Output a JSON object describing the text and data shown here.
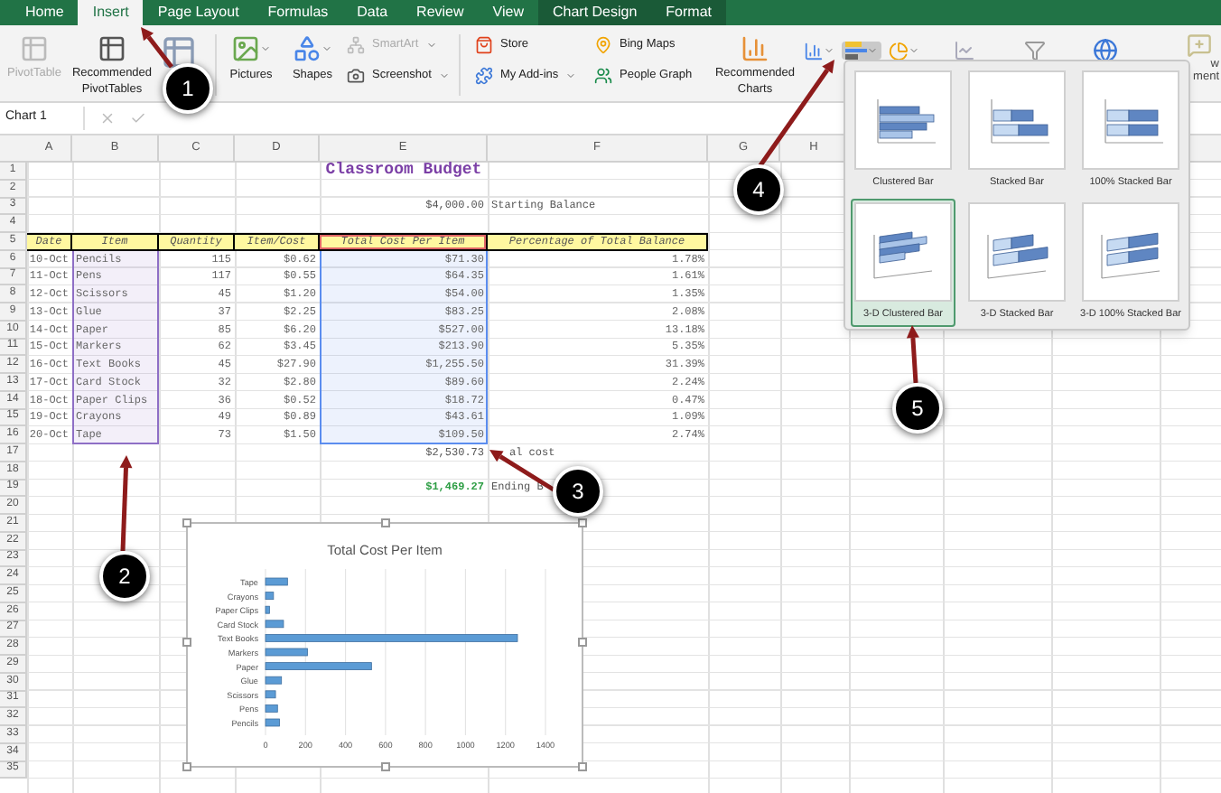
{
  "tabs": [
    {
      "label": "Home",
      "selected": false,
      "contextual": false
    },
    {
      "label": "Insert",
      "selected": true,
      "contextual": false
    },
    {
      "label": "Page Layout",
      "selected": false,
      "contextual": false
    },
    {
      "label": "Formulas",
      "selected": false,
      "contextual": false
    },
    {
      "label": "Data",
      "selected": false,
      "contextual": false
    },
    {
      "label": "Review",
      "selected": false,
      "contextual": false
    },
    {
      "label": "View",
      "selected": false,
      "contextual": false
    },
    {
      "label": "Chart Design",
      "selected": false,
      "contextual": true
    },
    {
      "label": "Format",
      "selected": false,
      "contextual": true
    }
  ],
  "ribbon": {
    "pivot_table": {
      "lines": [
        "PivotTable"
      ],
      "disabled": true
    },
    "recommended_pivot": {
      "lines": [
        "Recommended",
        "PivotTables"
      ],
      "disabled": false
    },
    "pictures": {
      "label": "Pictures"
    },
    "shapes": {
      "label": "Shapes"
    },
    "smartart": {
      "label": "SmartArt",
      "disabled": true
    },
    "screenshot": {
      "label": "Screenshot",
      "disabled": false
    },
    "store": {
      "label": "Store"
    },
    "add_ins": {
      "label": "My Add-ins"
    },
    "bing_maps": {
      "label": "Bing Maps"
    },
    "people_graph": {
      "label": "People Graph"
    },
    "recommended_charts": {
      "lines": [
        "Recommended",
        "Charts"
      ]
    },
    "bar_chart_menu": {
      "expanded": true
    },
    "comment": {
      "lines": [
        "w",
        "ment"
      ]
    }
  },
  "formula_bar": {
    "name_box": "Chart 1"
  },
  "sheet": {
    "columns": [
      "A",
      "B",
      "C",
      "D",
      "E",
      "F",
      "G",
      "H"
    ],
    "row_numbers": [
      "1",
      "2",
      "3",
      "4",
      "5",
      "6",
      "7",
      "8",
      "9",
      "10",
      "11",
      "12",
      "13",
      "14",
      "15",
      "16",
      "17",
      "18",
      "19",
      "20",
      "21",
      "22",
      "23",
      "24",
      "25",
      "26",
      "27",
      "28",
      "29",
      "30",
      "31",
      "32",
      "33",
      "34",
      "35"
    ],
    "title": "Classroom Budget",
    "starting_balance": {
      "value": "$4,000.00",
      "label": "Starting Balance"
    },
    "headers": [
      {
        "label": "Date"
      },
      {
        "label": "Item"
      },
      {
        "label": "Quantity"
      },
      {
        "label": "Item/Cost"
      },
      {
        "label": "Total Cost Per Item",
        "color": "#e06666"
      },
      {
        "label": "Percentage of Total Balance"
      }
    ],
    "ranges": [
      {
        "color": "#8e6fc6"
      },
      {
        "color": "#5b8def"
      }
    ],
    "rows": [
      {
        "date": "10-Oct",
        "item": "Pencils",
        "quantity": "115",
        "item_cost": "$0.62",
        "total_cost": "$71.30",
        "percentage": "1.78%"
      },
      {
        "date": "11-Oct",
        "item": "Pens",
        "quantity": "117",
        "item_cost": "$0.55",
        "total_cost": "$64.35",
        "percentage": "1.61%"
      },
      {
        "date": "12-Oct",
        "item": "Scissors",
        "quantity": "45",
        "item_cost": "$1.20",
        "total_cost": "$54.00",
        "percentage": "1.35%"
      },
      {
        "date": "13-Oct",
        "item": "Glue",
        "quantity": "37",
        "item_cost": "$2.25",
        "total_cost": "$83.25",
        "percentage": "2.08%"
      },
      {
        "date": "14-Oct",
        "item": "Paper",
        "quantity": "85",
        "item_cost": "$6.20",
        "total_cost": "$527.00",
        "percentage": "13.18%"
      },
      {
        "date": "15-Oct",
        "item": "Markers",
        "quantity": "62",
        "item_cost": "$3.45",
        "total_cost": "$213.90",
        "percentage": "5.35%"
      },
      {
        "date": "16-Oct",
        "item": "Text Books",
        "quantity": "45",
        "item_cost": "$27.90",
        "total_cost": "$1,255.50",
        "percentage": "31.39%"
      },
      {
        "date": "17-Oct",
        "item": "Card Stock",
        "quantity": "32",
        "item_cost": "$2.80",
        "total_cost": "$89.60",
        "percentage": "2.24%"
      },
      {
        "date": "18-Oct",
        "item": "Paper Clips",
        "quantity": "36",
        "item_cost": "$0.52",
        "total_cost": "$18.72",
        "percentage": "0.47%"
      },
      {
        "date": "19-Oct",
        "item": "Crayons",
        "quantity": "49",
        "item_cost": "$0.89",
        "total_cost": "$43.61",
        "percentage": "1.09%"
      },
      {
        "date": "20-Oct",
        "item": "Tape",
        "quantity": "73",
        "item_cost": "$1.50",
        "total_cost": "$109.50",
        "percentage": "2.74%"
      }
    ],
    "total": {
      "value": "$2,530.73",
      "label": "al cost"
    },
    "ending": {
      "value": "$1,469.27",
      "label": "Ending B"
    }
  },
  "chart": {
    "chart_data": {
      "type": "bar",
      "orientation": "horizontal",
      "title": "Total Cost Per Item",
      "grid": true,
      "categories": [
        "Tape",
        "Crayons",
        "Paper Clips",
        "Card Stock",
        "Text Books",
        "Markers",
        "Paper",
        "Glue",
        "Scissors",
        "Pens",
        "Pencils"
      ],
      "series": [
        {
          "color": "#5b9bd5",
          "values": [
            110,
            40,
            20,
            90,
            1260,
            210,
            530,
            80,
            50,
            60,
            70
          ]
        }
      ],
      "xlim": [
        0,
        1400
      ],
      "xticks": [
        0,
        200,
        400,
        600,
        800,
        1000,
        1200,
        1400
      ]
    }
  },
  "chart_menu": {
    "options": [
      {
        "label": "Clustered Bar",
        "selected": false
      },
      {
        "label": "Stacked Bar",
        "selected": false
      },
      {
        "label": "100% Stacked Bar",
        "selected": false
      },
      {
        "label": "3-D Clustered Bar",
        "selected": true
      },
      {
        "label": "3-D Stacked Bar",
        "selected": false
      },
      {
        "label": "3-D 100% Stacked Bar",
        "selected": false
      }
    ]
  },
  "callouts": [
    {
      "number": "1"
    },
    {
      "number": "2"
    },
    {
      "number": "3"
    },
    {
      "number": "4"
    },
    {
      "number": "5"
    }
  ]
}
